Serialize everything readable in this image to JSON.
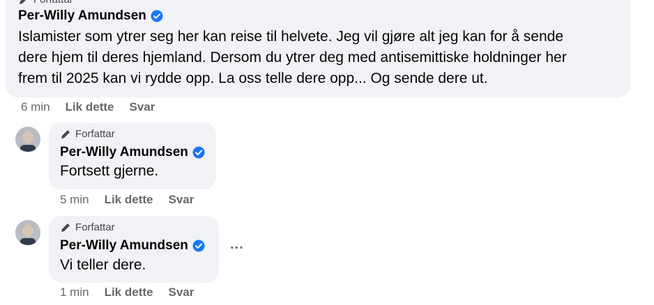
{
  "comments": [
    {
      "author_tag": "Forfattar",
      "author": "Per-Willy Amundsen",
      "text_lines": [
        "Islamister som ytrer seg her kan reise til helvete. Jeg vil gjøre alt jeg kan for å sende",
        "dere hjem til deres hjemland. Dersom du ytrer deg med antisemittiske holdninger her",
        "frem til 2025 kan vi rydde opp. La oss telle dere opp... Og sende dere ut."
      ],
      "time": "6 min",
      "like": "Lik dette",
      "reply": "Svar"
    },
    {
      "author_tag": "Forfattar",
      "author": "Per-Willy Amundsen",
      "text": "Fortsett gjerne.",
      "time": "5 min",
      "like": "Lik dette",
      "reply": "Svar"
    },
    {
      "author_tag": "Forfattar",
      "author": "Per-Willy Amundsen",
      "text": "Vi teller dere.",
      "time": "1 min",
      "like": "Lik dette",
      "reply": "Svar",
      "more": "..."
    }
  ],
  "colors": {
    "bubble": "#f0f2f5",
    "verified": "#1877f2",
    "meta": "#65676b"
  }
}
